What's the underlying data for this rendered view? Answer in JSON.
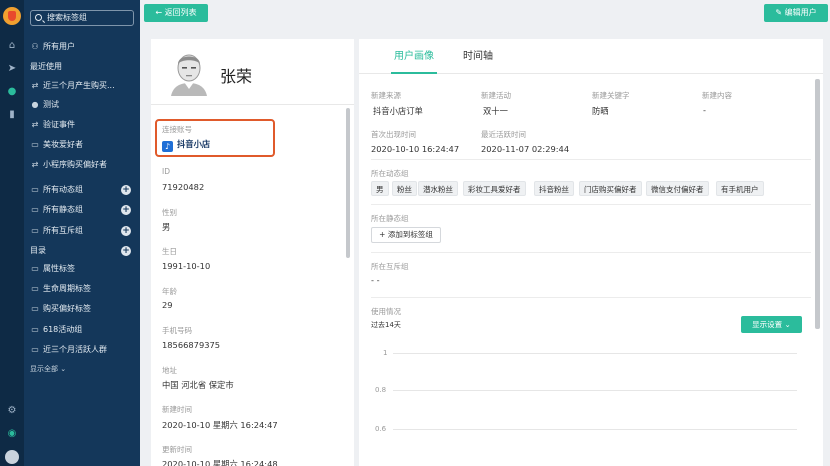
{
  "search": {
    "placeholder": "搜索标签组"
  },
  "sidebar": {
    "all_users": "所有用户",
    "recent": "最近使用",
    "recent_items": [
      "近三个月产生购买...",
      "测试",
      "验证事件",
      "美妆爱好者",
      "小程序购买偏好者"
    ],
    "dynamic_group": "所有动态组",
    "static_group": "所有静态组",
    "mutex_group": "所有互斥组",
    "catalog": "目录",
    "catalog_items": [
      "属性标签",
      "生命周期标签",
      "购买偏好标签",
      "618活动组",
      "近三个月活跃人群"
    ],
    "show_all": "显示全部"
  },
  "toolbar": {
    "back": "返回列表",
    "edit": "编辑用户"
  },
  "profile": {
    "name": "张荣",
    "linked_label": "连接账号",
    "linked_value": "抖音小店",
    "fields": [
      {
        "label": "ID",
        "value": "71920482"
      },
      {
        "label": "性别",
        "value": "男"
      },
      {
        "label": "生日",
        "value": "1991-10-10"
      },
      {
        "label": "年龄",
        "value": "29"
      },
      {
        "label": "手机号码",
        "value": "18566879375"
      },
      {
        "label": "地址",
        "value": "中国 河北省 保定市"
      },
      {
        "label": "新建时间",
        "value": "2020-10-10 星期六 16:24:47"
      },
      {
        "label": "更新时间",
        "value": "2020-10-10 星期六 16:24:48"
      }
    ]
  },
  "tabs": [
    "用户画像",
    "时间轴"
  ],
  "portrait": {
    "new_source_label": "新建来源",
    "new_source": "抖音小店订单",
    "new_activity_label": "新建活动",
    "new_activity": "双十一",
    "new_keyword_label": "新建关键字",
    "new_keyword": "防晒",
    "new_content_label": "新建内容",
    "new_content": "-",
    "first_seen_label": "首次出现时间",
    "first_seen": "2020-10-10 16:24:47",
    "last_active_label": "最近活跃时间",
    "last_active": "2020-11-07 02:29:44",
    "dynamic_label": "所在动态组",
    "dynamic_tags": [
      "男",
      "粉丝",
      "潜水粉丝",
      "彩妆工具爱好者",
      "抖音粉丝",
      "门店购买偏好者",
      "微信支付偏好者",
      "有手机用户"
    ],
    "static_label": "所在静态组",
    "add_to_group": "添加到标签组",
    "mutex_label": "所在互斥组",
    "mutex_value": "- -",
    "usage_label": "使用情况",
    "usage_range": "过去14天",
    "display_settings": "显示设置",
    "y_ticks": [
      "1",
      "0.8",
      "0.6"
    ]
  }
}
